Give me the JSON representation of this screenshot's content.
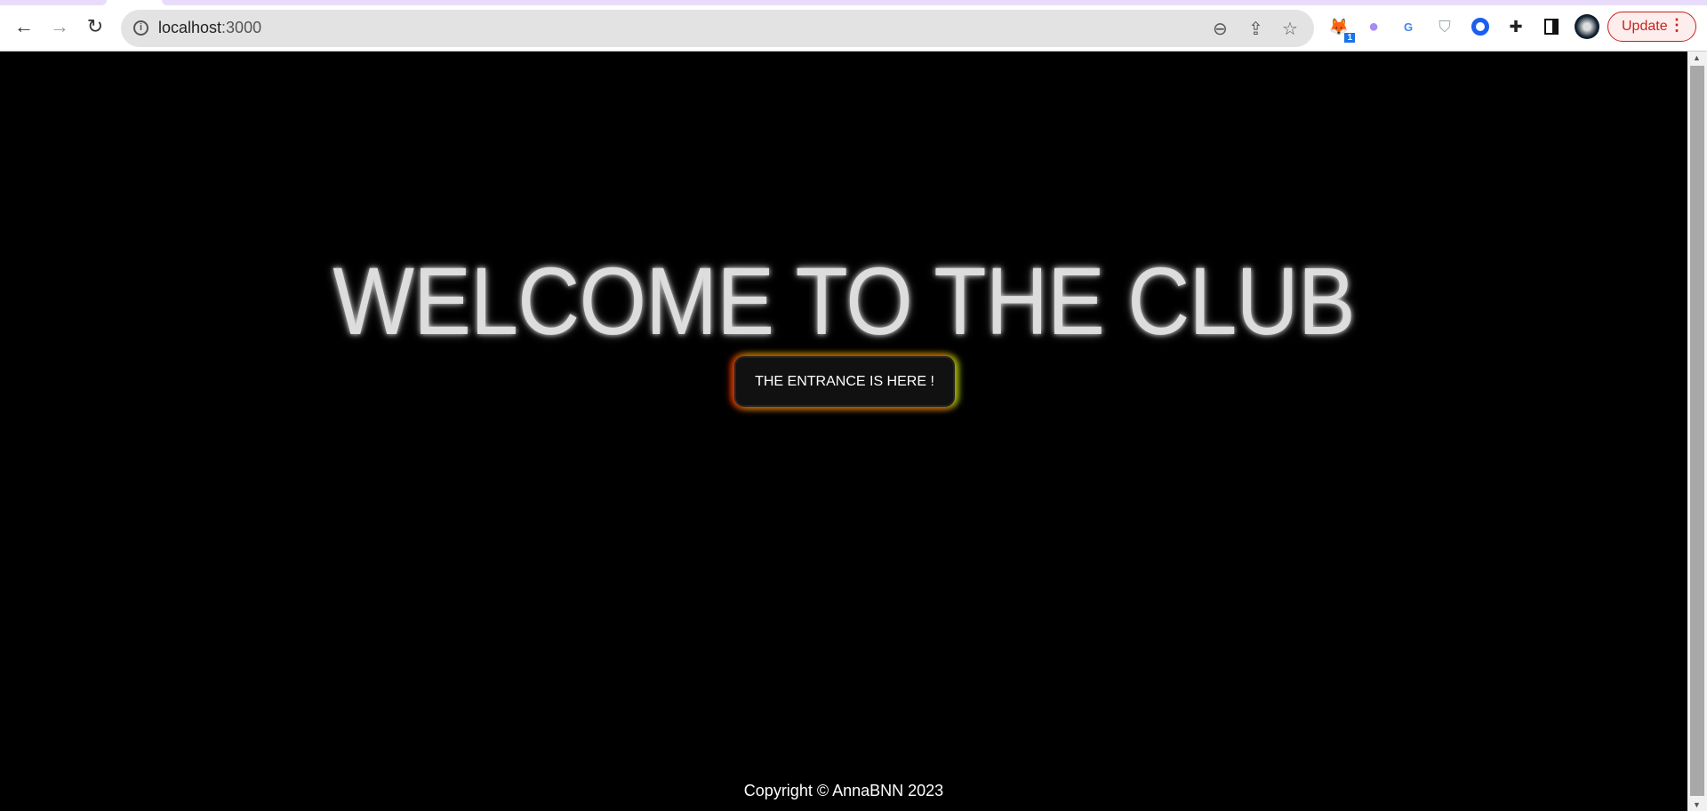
{
  "browser": {
    "url_host": "localhost",
    "url_port": ":3000",
    "update_label": "Update",
    "extension_badge": "1",
    "icons": [
      "back-icon",
      "forward-icon",
      "reload-icon",
      "info-icon",
      "zoom-out-icon",
      "share-icon",
      "star-icon",
      "metamask-icon",
      "ghost-icon",
      "translate-icon",
      "shield-icon",
      "target-icon",
      "puzzle-icon",
      "side-panel-icon",
      "profile-avatar",
      "more-icon"
    ]
  },
  "page": {
    "title": "WELCOME TO THE CLUB",
    "button_label": "THE ENTRANCE IS HERE !",
    "footer": "Copyright © AnnaBNN 2023",
    "colors": {
      "background": "#000000",
      "button_glow_left": "#d22a00",
      "button_glow_right": "#9cc800"
    }
  }
}
